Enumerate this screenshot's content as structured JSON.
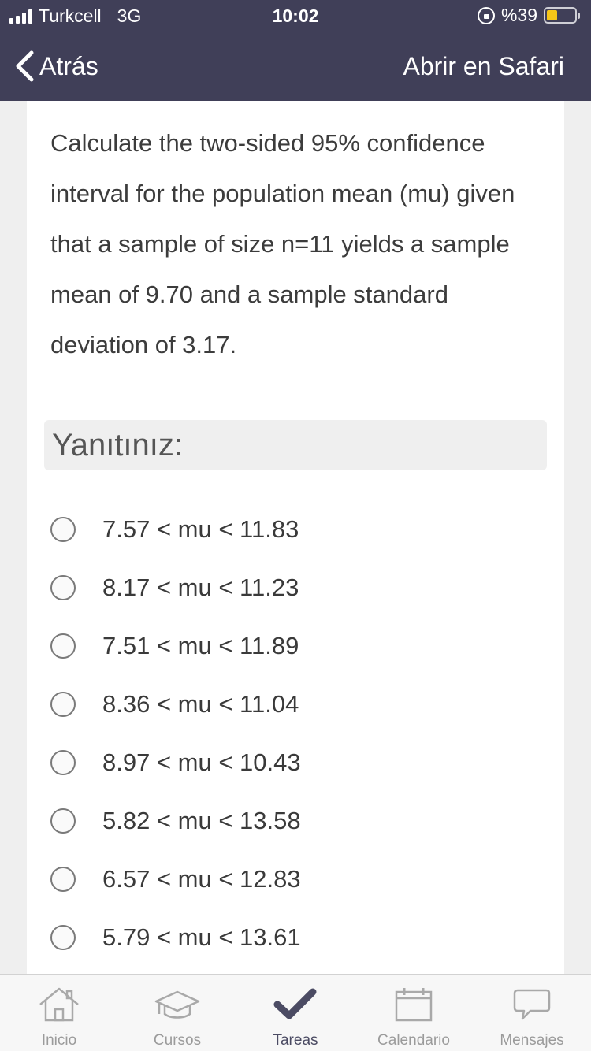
{
  "status_bar": {
    "carrier": "Turkcell",
    "network": "3G",
    "time": "10:02",
    "battery_text": "%39",
    "battery_level": 0.39,
    "battery_color": "#f5c518"
  },
  "nav": {
    "back_label": "Atrás",
    "open_in_safari_label": "Abrir en Safari"
  },
  "question": {
    "text": "Calculate the two-sided 95% confidence interval for the population mean (mu) given that a sample of size n=11 yields a sample mean of 9.70 and a sample standard deviation of 3.17."
  },
  "answer_header": "Yanıtınız:",
  "options": [
    {
      "label": "7.57 < mu < 11.83",
      "selected": false
    },
    {
      "label": "8.17 < mu < 11.23",
      "selected": false
    },
    {
      "label": "7.51 < mu < 11.89",
      "selected": false
    },
    {
      "label": "8.36 < mu < 11.04",
      "selected": false
    },
    {
      "label": "8.97 < mu < 10.43",
      "selected": false
    },
    {
      "label": "5.82 < mu < 13.58",
      "selected": false
    },
    {
      "label": "6.57 < mu < 12.83",
      "selected": false
    },
    {
      "label": "5.79 < mu < 13.61",
      "selected": false
    }
  ],
  "tabbar": {
    "tabs": [
      {
        "label": "Inicio",
        "icon": "home-icon"
      },
      {
        "label": "Cursos",
        "icon": "graduation-cap-icon"
      },
      {
        "label": "Tareas",
        "icon": "checkmark-icon",
        "active": true
      },
      {
        "label": "Calendario",
        "icon": "calendar-icon"
      },
      {
        "label": "Mensajes",
        "icon": "speech-bubble-icon"
      }
    ]
  },
  "colors": {
    "header_bg": "#403f58",
    "active_tab": "#4b4b63",
    "inactive_tab": "#9b9b9b"
  }
}
